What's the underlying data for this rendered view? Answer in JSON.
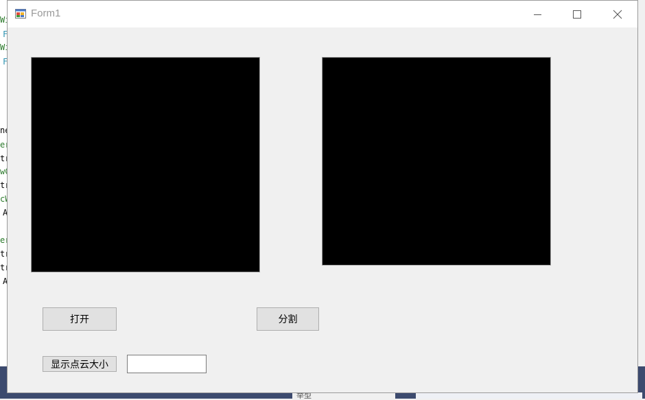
{
  "window": {
    "title": "Form1",
    "minimize_glyph": "─",
    "maximize_glyph": "☐",
    "close_glyph": "✕"
  },
  "buttons": {
    "open_label": "打开",
    "segment_label": "分割",
    "show_point_size_label": "显示点云大小"
  },
  "point_size_input": {
    "value": ""
  },
  "background": {
    "code_fragments": [
      "Wi",
      "F",
      "Wi",
      "F",
      "ne",
      "er",
      "tr",
      "wC",
      "tr",
      "cW",
      "A",
      "er",
      "tr",
      "tr",
      "A"
    ],
    "bottom_panel_text": "举型"
  },
  "colors": {
    "picture_box": "#000000",
    "form_background": "#f0f0f0",
    "button_face": "#e1e1e1"
  }
}
